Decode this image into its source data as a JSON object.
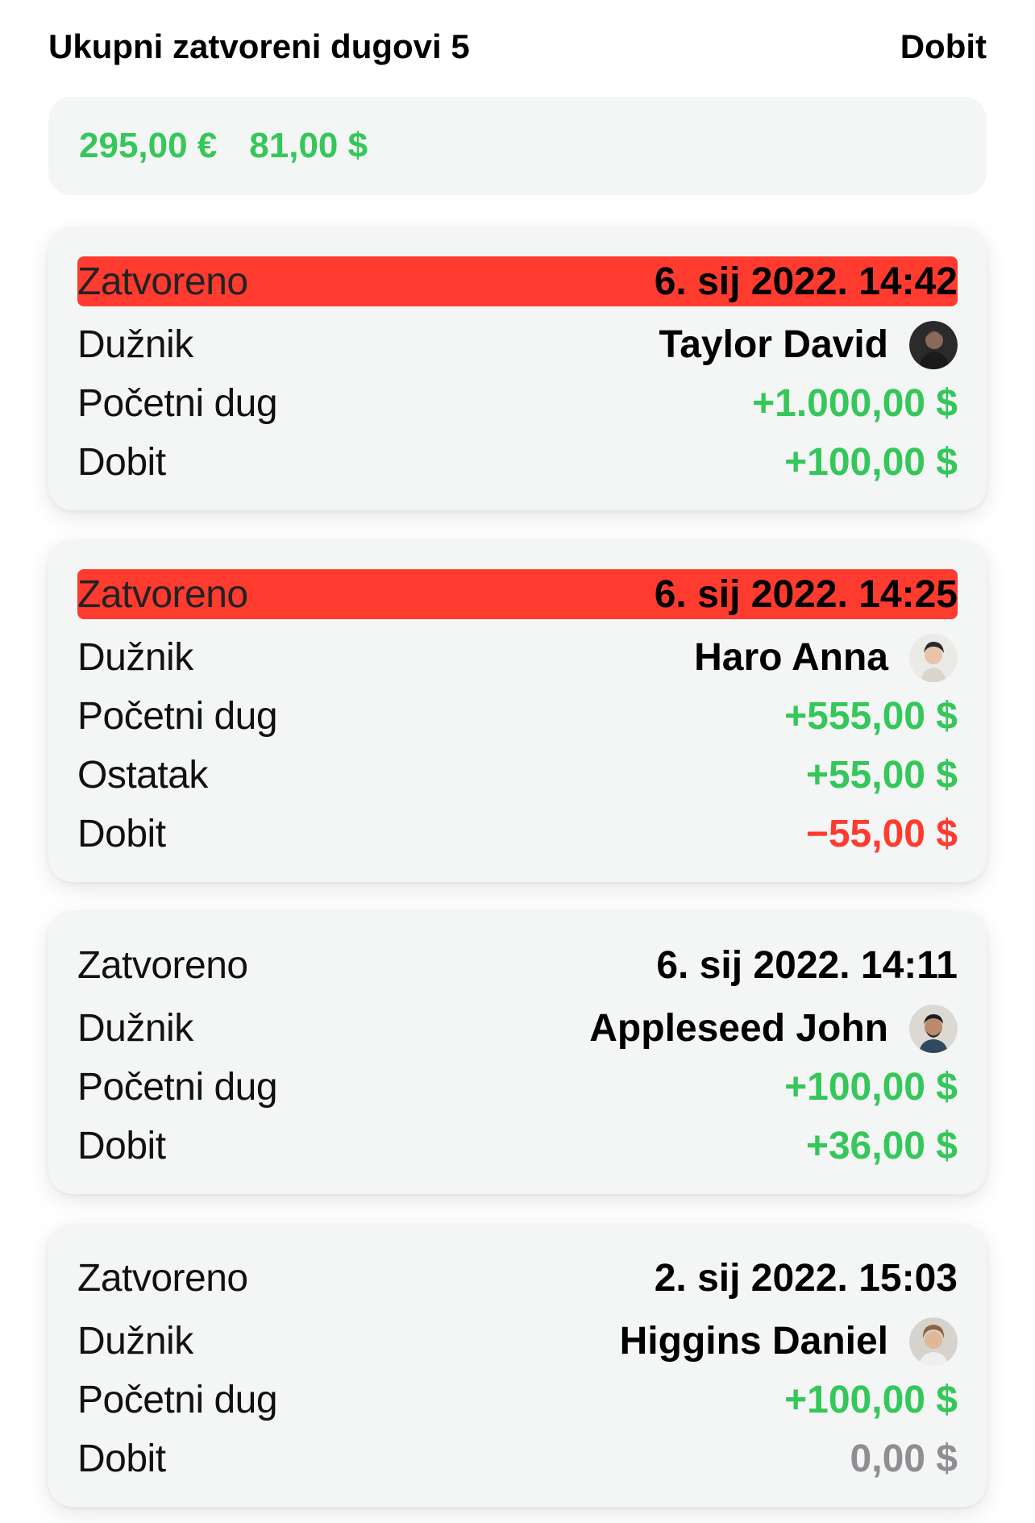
{
  "header": {
    "title": "Ukupni zatvoreni dugovi 5",
    "right_label": "Dobit"
  },
  "summary": {
    "amounts": [
      "295,00 €",
      "81,00 $"
    ]
  },
  "colors": {
    "positive": "#34c759",
    "negative": "#ff3b30",
    "neutral": "#8e8e93",
    "highlight": "#ff3b30",
    "card_bg": "#f4f5f5"
  },
  "cards": [
    {
      "highlighted": true,
      "closed_label": "Zatvoreno",
      "closed_date": "6. sij 2022. 14:42",
      "debtor_label": "Dužnik",
      "debtor_name": "Taylor David",
      "avatar_icon": "avatar-photo-icon",
      "initial_label": "Početni dug",
      "initial_value": "+1.000,00 $",
      "profit_label": "Dobit",
      "profit_value": "+100,00 $"
    },
    {
      "highlighted": true,
      "closed_label": "Zatvoreno",
      "closed_date": "6. sij 2022. 14:25",
      "debtor_label": "Dužnik",
      "debtor_name": "Haro Anna",
      "avatar_icon": "avatar-photo-icon",
      "initial_label": "Početni dug",
      "initial_value": "+555,00 $",
      "remainder_label": "Ostatak",
      "remainder_value": "+55,00 $",
      "profit_label": "Dobit",
      "profit_value": "−55,00 $"
    },
    {
      "highlighted": false,
      "closed_label": "Zatvoreno",
      "closed_date": "6. sij 2022. 14:11",
      "debtor_label": "Dužnik",
      "debtor_name": "Appleseed John",
      "avatar_icon": "avatar-photo-icon",
      "initial_label": "Početni dug",
      "initial_value": "+100,00 $",
      "profit_label": "Dobit",
      "profit_value": "+36,00 $"
    },
    {
      "highlighted": false,
      "closed_label": "Zatvoreno",
      "closed_date": "2. sij 2022. 15:03",
      "debtor_label": "Dužnik",
      "debtor_name": "Higgins Daniel",
      "avatar_icon": "avatar-photo-icon",
      "initial_label": "Početni dug",
      "initial_value": "+100,00 $",
      "profit_label": "Dobit",
      "profit_value": "0,00 $"
    }
  ]
}
